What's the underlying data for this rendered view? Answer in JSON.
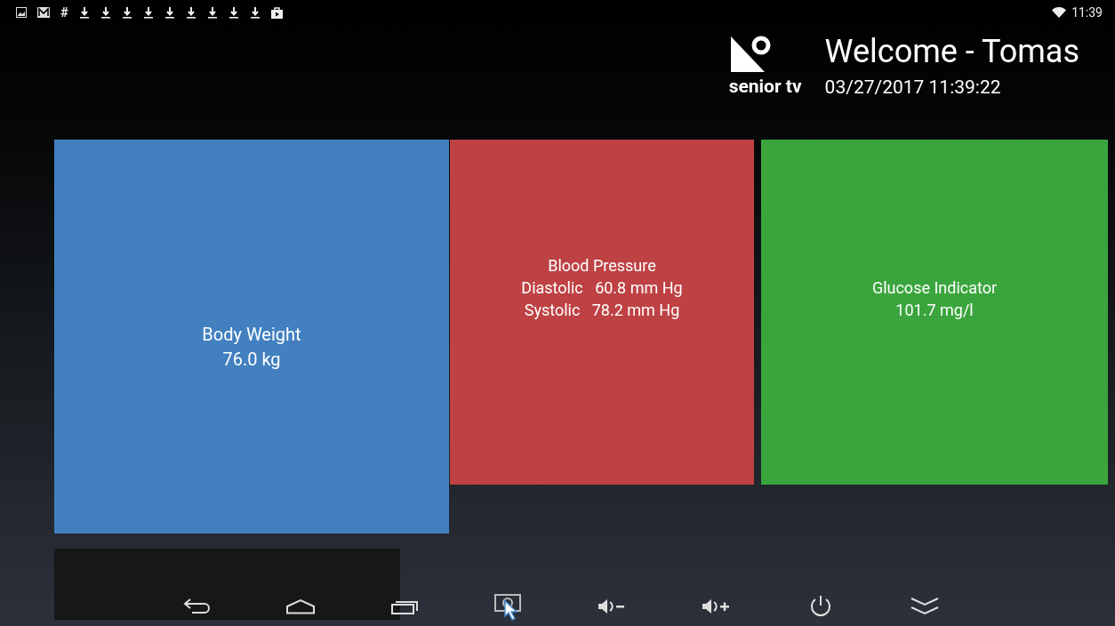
{
  "status_bar": {
    "notifications": [
      {
        "kind": "image"
      },
      {
        "kind": "mail"
      },
      {
        "kind": "text",
        "text": "#"
      },
      {
        "kind": "download"
      },
      {
        "kind": "download"
      },
      {
        "kind": "download"
      },
      {
        "kind": "download"
      },
      {
        "kind": "download"
      },
      {
        "kind": "download"
      },
      {
        "kind": "download"
      },
      {
        "kind": "download"
      },
      {
        "kind": "download"
      },
      {
        "kind": "store"
      }
    ],
    "time": "11:39"
  },
  "header": {
    "logo_text": "senior tv",
    "welcome": "Welcome - Tomas",
    "datetime": "03/27/2017 11:39:22"
  },
  "tiles": [
    {
      "color": "#4280c0",
      "lines": [
        "Body Weight",
        "76.0 kg"
      ]
    },
    {
      "color": "#be4244",
      "lines": [
        "Blood Pressure",
        "Diastolic   60.8 mm Hg",
        "Systolic   78.2 mm Hg"
      ]
    },
    {
      "color": "#3ba53d",
      "lines": [
        "Glucose Indicator",
        "101.7 mg/l"
      ]
    }
  ],
  "nav_bar": [
    {
      "kind": "back"
    },
    {
      "kind": "home"
    },
    {
      "kind": "recents"
    },
    {
      "kind": "screenshot"
    },
    {
      "kind": "volume-down"
    },
    {
      "kind": "volume-up"
    },
    {
      "kind": "power"
    },
    {
      "kind": "collapse"
    }
  ]
}
